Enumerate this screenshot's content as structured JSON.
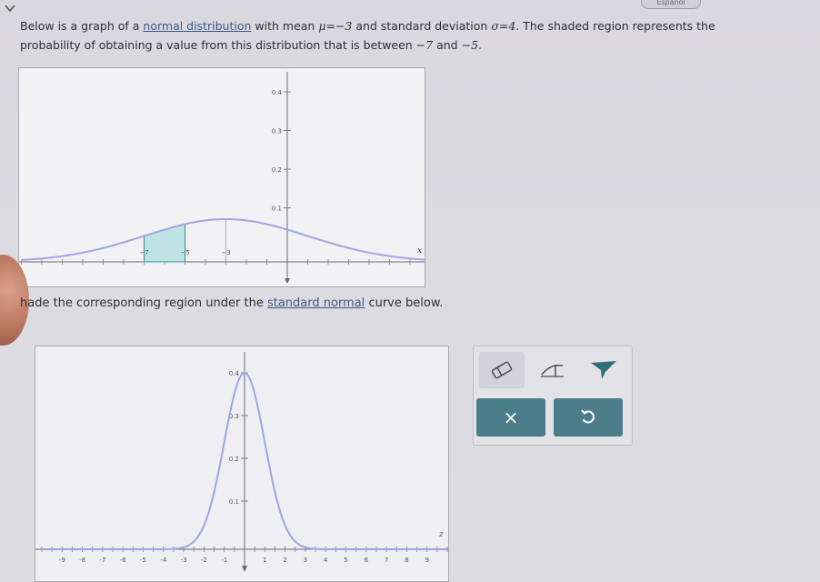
{
  "header": {
    "language_button": "Español"
  },
  "problem": {
    "line1_a": "Below is a graph of a ",
    "line1_link": "normal distribution",
    "line1_b": " with mean ",
    "mu_symbol": "μ",
    "mean_value": "=−3",
    "line1_c": " and standard deviation ",
    "sigma_symbol": "σ",
    "sd_value": "=4",
    "line1_d": ". The shaded region represents the",
    "line2_a": "probability of obtaining a value from this distribution that is between ",
    "lower": "−7",
    "and": " and ",
    "upper": "−5",
    "line2_end": "."
  },
  "graph1": {
    "mean": -3,
    "sd": 4,
    "shade_from": -7,
    "shade_to": -5,
    "y_ticks": [
      "0.4",
      "0.3",
      "0.2",
      "0.1"
    ],
    "x_labels": [
      "−7",
      "−5",
      "−3"
    ],
    "x_axis_label": "x",
    "curve_color": "#a3a4e6",
    "shade_color": "#bfe3e4",
    "shade_edge_color": "#3e8e93"
  },
  "instruction": {
    "text_a": "hade the corresponding region under the ",
    "link": "standard normal",
    "text_b": " curve below."
  },
  "graph2": {
    "mean": 0,
    "sd": 1,
    "y_ticks": [
      "0.4",
      "0.3",
      "0.2",
      "0.1"
    ],
    "x_labels": [
      "-9",
      "-8",
      "-7",
      "-6",
      "-5",
      "-4",
      "-3",
      "-2",
      "-1",
      "1",
      "2",
      "3",
      "4",
      "5",
      "6",
      "7",
      "8",
      "9"
    ],
    "x_axis_label": "z",
    "curve_color": "#9fa3e8"
  },
  "tools": {
    "eraser_icon": "eraser-icon",
    "boundary_icon": "boundary-line-icon",
    "fill_icon": "shade-fill-icon",
    "clear_label": "×",
    "undo_icon": "undo-icon"
  }
}
